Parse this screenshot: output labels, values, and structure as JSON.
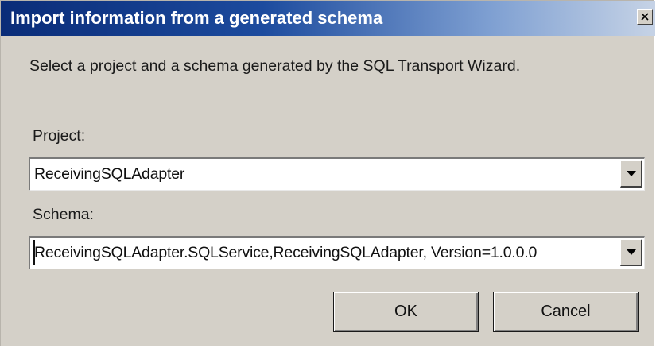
{
  "dialog": {
    "title": "Import information from a generated schema",
    "close_label": "×",
    "instruction": "Select a project and a schema generated by the SQL Transport Wizard."
  },
  "project": {
    "label": "Project:",
    "selected_value": "ReceivingSQLAdapter"
  },
  "schema": {
    "label": "Schema:",
    "selected_value": "ReceivingSQLAdapter.SQLService,ReceivingSQLAdapter, Version=1.0.0.0"
  },
  "buttons": {
    "ok_label": "OK",
    "cancel_label": "Cancel"
  },
  "colors": {
    "title_bar_start": "#0a2c78",
    "title_bar_end": "#c6d3e6",
    "dialog_face": "#d4d0c8"
  },
  "icons": {
    "close": "close-icon",
    "dropdown": "chevron-down-icon"
  }
}
